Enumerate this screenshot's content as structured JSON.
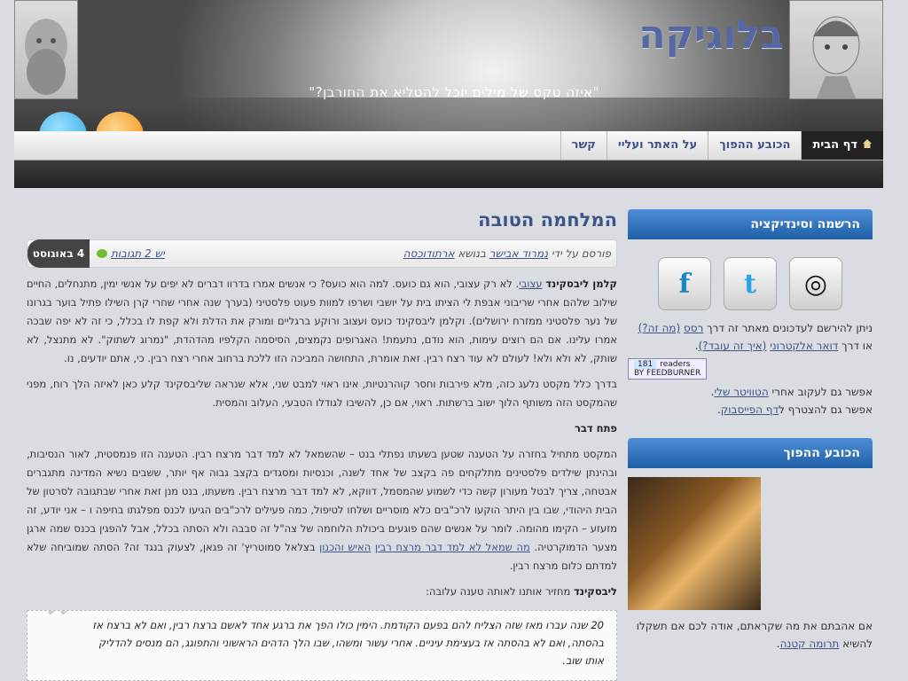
{
  "header": {
    "site_title": "בלוגיקה",
    "tagline": "\"איזה טקס של מילים יוכל להטליא את החורבן?\""
  },
  "nav": {
    "items": [
      {
        "label": "דף הבית",
        "icon": "home-icon"
      },
      {
        "label": "הכובע ההפוך"
      },
      {
        "label": "על האתר ועליי"
      },
      {
        "label": "קשר"
      }
    ]
  },
  "post": {
    "title": "המלחמה הטובה",
    "date": "4 באוגוסט",
    "comments": "יש 2 תגובות",
    "byline_prefix": "פורסם על ידי",
    "author": "נמרוד אבישר",
    "topic_prefix": "בנושא",
    "topic": "ארתודוכסה",
    "paragraph1_lead": "קלמן ליבסקינד",
    "paragraph1_link": "עצובי",
    "paragraph1": ". לא רק עצובי, הוא גם כועס. למה הוא כועס? כי אנשים אמרו בדרוו דברים לא יפים על אנשי ימין, מתנחלים, החיים שילוב שלהם אחרי שריבוני אבפת לי הציתו בית על יושבי ושרפו למוות פעוט פלסטיני (בערך שנה אחרי שחרי קרן השילו פתיל בוער בגרונו של נער פלסטיני ממזרח ירושלים). וקלמן ליבסקינד כועס ועצוב ורוקע ברגליים ומורק את הדלת ולא קפת לו בכלל, כי זה לא יפה שבכה אמרו עלינו. אם הם רוצים עימות, הוא נודם, נתעמת! האגרופים נקמצים, הסיסמה הקלפיו מהדהדת, \"נמרוג לשתוק\". לא מתנצל, לא שותק, לא ולא ולא! לעולם לא עוד רצח רבין. זאת אומרת, התחושה המביכה הזו ללכת ברחוב אחרי רצח רבין. כי, אתם יודעים, נו.",
    "paragraph2": "בדרך כלל מקסט נלעג כזה, מלא פירבות וחסר קוהרנטיות, אינו ראוי למבט שני, אלא שנראה שליבסקינד קלע כאן לאיזה הלך רוח, מפני שהמקסט הזה משותף הלוך ישוב ברשתות. ראוי, אם כן, להשיבו לגודלו הטבעי, העלוב והמסית.",
    "heading": "פתח דבר",
    "paragraph3_link1": "מה שמאל לא למד דבר מרצח רבין",
    "paragraph3": "המקסט מתחיל בחזרה על הטענה שטען בשעתו נפתלי בנט – שהשמאל לא למד דבר מרצח רבין. הטענה הזו פנמסטית, לאור הנסיבות, ובהינתן שילדים פלסטינים מתלקחים פה בקצב של אחד לשנה, וכנסיות ומסגדים בקצב גבוה אף יותר, ששבים נשיא המדינה מתגברים אבטחה, צריך לבטל מעורון קשה כדי לשמוע שהמסמל, דווקא, לא למד דבר מרצח רבין. משעתו, בנט מנן זאת אחרי שבתגובה לסרטון של הבית היהודי, שבו בין היתר הוקעו לרכ\"בים כלא מוסריים ושלחו לטיפול, כמה פעילים לרכ\"בים הגיעו לכנס מפלגתו בחיפה ו – אני יודע, זה מזעזע – הקימו מהומה. לומר על אנשים שהם פוגעים ביכולת הלוחמה של צה\"ל זה סבבה ולא הסתה בכלל, אבל להפגין בכנס שמה ארגן מצער הדמוקרטיה.",
    "paragraph3_link2": "האיש והכנון",
    "paragraph3_tail": "בצלאל סמוטריץ' זה פגאן, לצעוק בנגד זה? הסתה שמוביחה שלא למדתם כלום מרצח רבין.",
    "quote_intro_lead": "ליבסקינד",
    "quote_intro": "מחזיר אותנו לאותה טענה עלובה:",
    "quote": "20 שנה עברו מאז שזה הצליח להם בפעם הקודמת. הימין כולו הפך את ברגע אחד לאשם ברצח רבין, ואם לא ברצח אז בהסתה, ואם לא בהסתה אז בעצימת עיניים. אחרי עשור ומשהו, שבו הלך הדהים הראשוני והתפוגג, הם מנסים להדליק אותו שוב."
  },
  "sidebar": {
    "subscribe_title": "הרשמה וסינדיקציה",
    "subscribe_text_1": "ניתן להירשם לעדכונים מאתר זה דרך",
    "rss_link": "רסס",
    "what_link": "(מה זה?)",
    "or": "או דרך",
    "email_link": "דואר אלקטרוני",
    "how_link": "(איך זה עובד?)",
    "readers_count": "181",
    "readers_label": "readers",
    "feedburner": "BY FEEDBURNER",
    "follow_text": "אפשר גם לעקוב אחרי",
    "twitter_link": "הטוויטר שלי",
    "facebook_text": "אפשר גם להצטרף ל",
    "facebook_link": "דף הפייסבוק",
    "hat_title": "הכובע ההפוך",
    "hat_text": "אם אהבתם את מה שקראתם, אודה לכם אם תשקלו להשיא",
    "hat_link": "תרומה קטנה"
  },
  "colors": {
    "accent": "#3e5389",
    "widget_blue": "#2b6cb5"
  }
}
